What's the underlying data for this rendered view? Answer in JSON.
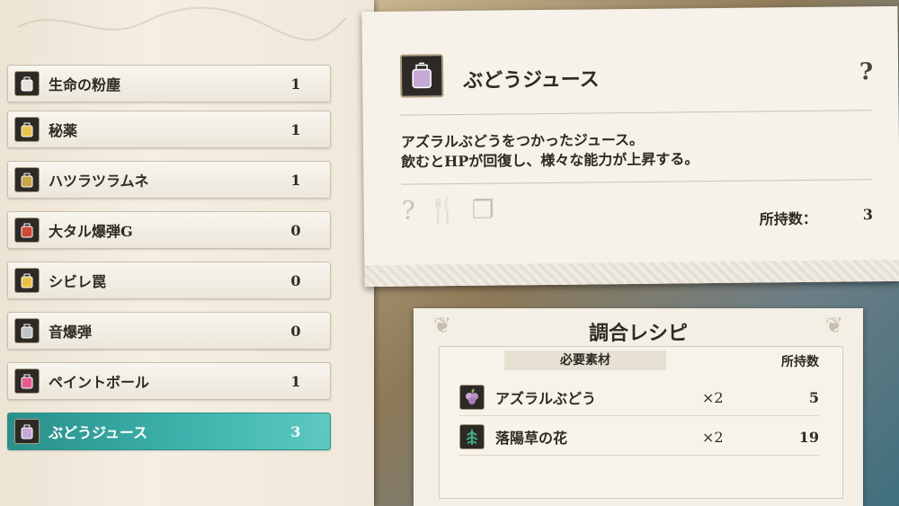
{
  "items": [
    {
      "name": "生命の粉塵",
      "count": "1",
      "icon": "dust-icon",
      "color": "#e8e4dc"
    },
    {
      "name": "秘薬",
      "count": "1",
      "icon": "potion-flask-icon",
      "color": "#e8c24a"
    },
    {
      "name": "ハツラツラムネ",
      "count": "1",
      "icon": "bottle-icon",
      "color": "#c9a64a"
    },
    {
      "name": "大タル爆弾G",
      "count": "0",
      "icon": "barrel-bomb-icon",
      "color": "#d04a3a"
    },
    {
      "name": "シビレ罠",
      "count": "0",
      "icon": "shock-trap-icon",
      "color": "#e8c24a"
    },
    {
      "name": "音爆弾",
      "count": "0",
      "icon": "sonic-bomb-icon",
      "color": "#bfc4c6"
    },
    {
      "name": "ペイントボール",
      "count": "1",
      "icon": "paintball-icon",
      "color": "#e35b8f"
    },
    {
      "name": "ぶどうジュース",
      "count": "3",
      "icon": "juice-jar-icon",
      "color": "#c7a9d8",
      "selected": true
    }
  ],
  "detail": {
    "title": "ぶどうジュース",
    "desc_line1": "アズラルぶどうをつかったジュース。",
    "desc_line2": "飲むとHPが回復し、様々な能力が上昇する。",
    "owned_label": "所持数：",
    "owned_value": "3",
    "help_glyph": "?"
  },
  "recipe": {
    "title": "調合レシピ",
    "materials_header": "必要素材",
    "owned_header": "所持数",
    "materials": [
      {
        "name": "アズラルぶどう",
        "qty": "×2",
        "owned": "5",
        "icon": "grape-icon"
      },
      {
        "name": "落陽草の花",
        "qty": "×2",
        "owned": "19",
        "icon": "herb-flower-icon"
      }
    ]
  },
  "colors": {
    "selected": "#3fb5ae",
    "parchment": "#f4eee3"
  }
}
